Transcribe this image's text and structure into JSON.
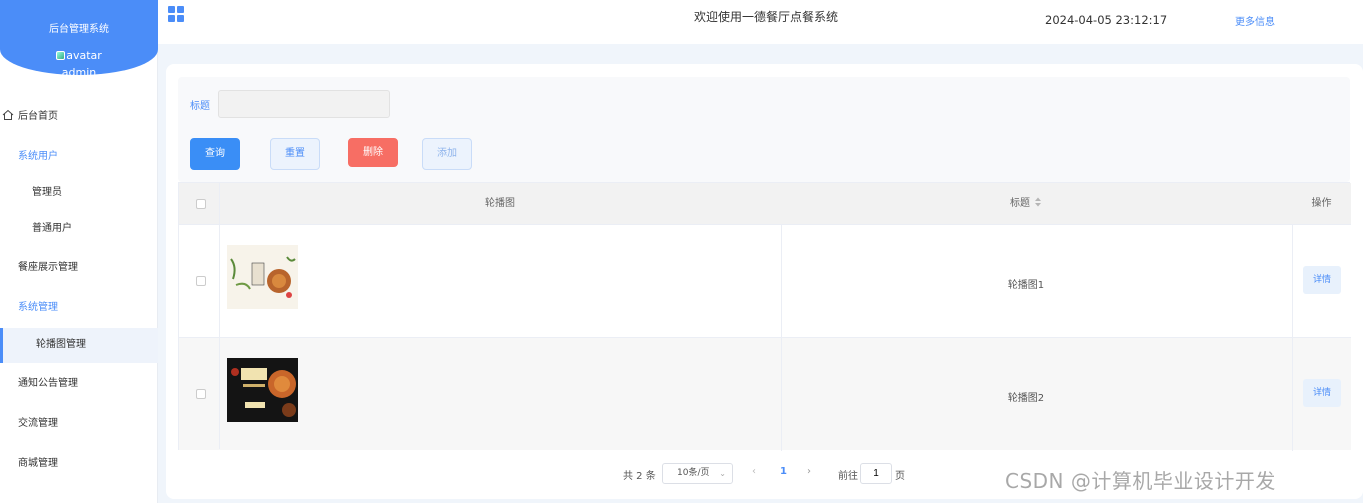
{
  "sidebar": {
    "system_name": "后台管理系统",
    "avatar_alt": "avatar",
    "username": "admin",
    "items": [
      {
        "label": "后台首页"
      },
      {
        "label": "系统用户"
      },
      {
        "label": "管理员"
      },
      {
        "label": "普通用户"
      },
      {
        "label": "餐座展示管理"
      },
      {
        "label": "系统管理"
      },
      {
        "label": "轮播图管理"
      },
      {
        "label": "通知公告管理"
      },
      {
        "label": "交流管理"
      },
      {
        "label": "商城管理"
      }
    ]
  },
  "header": {
    "title": "欢迎使用一德餐厅点餐系统",
    "datetime": "2024-04-05 23:12:17",
    "more_info": "更多信息"
  },
  "search": {
    "title_label": "标题",
    "title_value": ""
  },
  "buttons": {
    "query": "查询",
    "reset": "重置",
    "delete": "删除",
    "add": "添加"
  },
  "table": {
    "columns": [
      "轮播图",
      "标题",
      "操作"
    ],
    "rows": [
      {
        "title": "轮播图1",
        "action": "详情"
      },
      {
        "title": "轮播图2",
        "action": "详情"
      }
    ]
  },
  "pagination": {
    "total": "共 2 条",
    "page_size": "10条/页",
    "prev": "‹",
    "current": "1",
    "next": "›",
    "goto_label": "前往",
    "goto_value": "1",
    "page_suffix": "页"
  },
  "watermark": "CSDN @计算机毕业设计开发",
  "colors": {
    "primary": "#4b8df8",
    "danger": "#f76e64",
    "content_bg": "#f0f5fb"
  }
}
